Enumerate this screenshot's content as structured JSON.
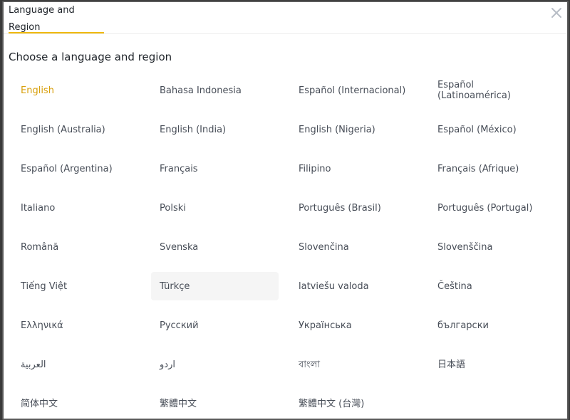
{
  "dialog": {
    "tab_label": "Language and Region",
    "close_icon": "close-icon",
    "heading": "Choose a language and region"
  },
  "colors": {
    "accent": "#f0b90b",
    "selected_text": "#d89f0b",
    "text": "#474d57",
    "hover_bg": "#f5f5f5"
  },
  "languages": [
    {
      "label": "English",
      "selected": true
    },
    {
      "label": "Bahasa Indonesia"
    },
    {
      "label": "Español (Internacional)"
    },
    {
      "label": "Español (Latinoamérica)"
    },
    {
      "label": "English (Australia)"
    },
    {
      "label": "English (India)"
    },
    {
      "label": "English (Nigeria)"
    },
    {
      "label": "Español (México)"
    },
    {
      "label": "Español (Argentina)"
    },
    {
      "label": "Français"
    },
    {
      "label": "Filipino"
    },
    {
      "label": "Français (Afrique)"
    },
    {
      "label": "Italiano"
    },
    {
      "label": "Polski"
    },
    {
      "label": "Português (Brasil)"
    },
    {
      "label": "Português (Portugal)"
    },
    {
      "label": "Română"
    },
    {
      "label": "Svenska"
    },
    {
      "label": "Slovenčina"
    },
    {
      "label": "Slovenščina"
    },
    {
      "label": "Tiếng Việt"
    },
    {
      "label": "Türkçe",
      "hovered": true
    },
    {
      "label": "latviešu valoda"
    },
    {
      "label": "Čeština"
    },
    {
      "label": "Ελληνικά"
    },
    {
      "label": "Русский"
    },
    {
      "label": "Українська"
    },
    {
      "label": "български"
    },
    {
      "label": "العربية"
    },
    {
      "label": "اردو"
    },
    {
      "label": "বাংলা"
    },
    {
      "label": "日本語"
    },
    {
      "label": "简体中文"
    },
    {
      "label": "繁體中文"
    },
    {
      "label": "繁體中文 (台灣)"
    }
  ]
}
